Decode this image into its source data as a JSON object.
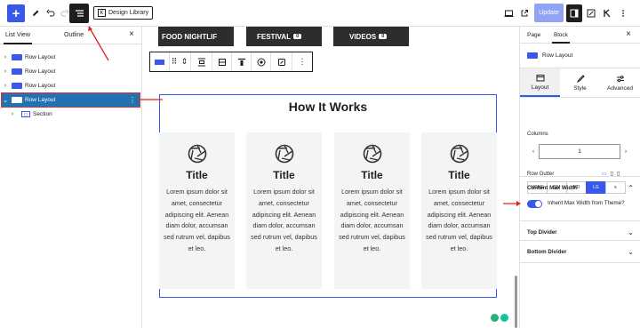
{
  "toolbar": {
    "add_icon": "+",
    "design_library_label": "Design Library",
    "update_label": "Update"
  },
  "left_panel": {
    "tabs": [
      "List View",
      "Outline"
    ],
    "rows": [
      {
        "label": "Row Layout"
      },
      {
        "label": "Row Layout"
      },
      {
        "label": "Row Layout"
      },
      {
        "label": "Row Layout"
      },
      {
        "label": "Section"
      }
    ]
  },
  "canvas": {
    "categories": [
      {
        "label": "FOOD NIGHTLIF",
        "count": "0"
      },
      {
        "label": "FESTIVAL",
        "count": "0"
      },
      {
        "label": "VIDEOS",
        "count": "0"
      }
    ],
    "heading": "How It Works",
    "cards": [
      {
        "title": "Title",
        "text": "Lorem ipsum dolor sit amet, consectetur adipiscing elit. Aenean diam dolor, accumsan sed rutrum vel, dapibus et leo."
      },
      {
        "title": "Title",
        "text": "Lorem ipsum dolor sit amet, consectetur adipiscing elit. Aenean diam dolor, accumsan sed rutrum vel, dapibus et leo."
      },
      {
        "title": "Title",
        "text": "Lorem ipsum dolor sit amet, consectetur adipiscing elit. Aenean diam dolor, accumsan sed rutrum vel, dapibus et leo."
      },
      {
        "title": "Title",
        "text": "Lorem ipsum dolor sit amet, consectetur adipiscing elit. Aenean diam dolor, accumsan sed rutrum vel, dapibus et leo."
      }
    ]
  },
  "right_panel": {
    "tabs": [
      "Page",
      "Block"
    ],
    "block_name": "Row Layout",
    "subtabs": [
      "Layout",
      "Style",
      "Advanced"
    ],
    "columns_label": "Columns",
    "columns_value": "1",
    "gutter_label": "Row Gutter",
    "gutter_options": [
      "NONE",
      "SM",
      "MD",
      "LG",
      "≡"
    ],
    "gutter_selected": "LG",
    "content_max_width_label": "Content Max Width",
    "inherit_label": "Inherit Max Width from Theme?",
    "top_divider_label": "Top Divider",
    "bottom_divider_label": "Bottom Divider"
  },
  "colors": {
    "accent": "#3858e9",
    "annotation": "#e0241b"
  }
}
